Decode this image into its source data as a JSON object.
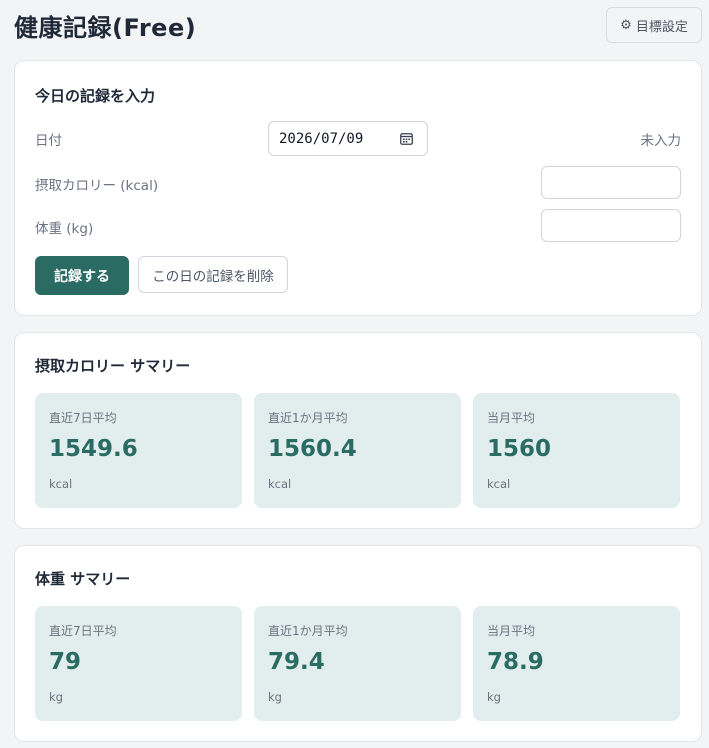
{
  "header": {
    "title": "健康記録(Free)",
    "goal_button_label": "目標設定"
  },
  "entry_form": {
    "title": "今日の記録を入力",
    "date_label": "日付",
    "date_value": "2026/07/09",
    "status": "未入力",
    "calorie_label": "摂取カロリー (kcal)",
    "calorie_value": "",
    "weight_label": "体重 (kg)",
    "weight_value": "",
    "save_button": "記録する",
    "delete_button": "この日の記録を削除"
  },
  "calorie_summary": {
    "title": "摂取カロリー サマリー",
    "stats": [
      {
        "label": "直近7日平均",
        "value": "1549.6",
        "unit": "kcal"
      },
      {
        "label": "直近1か月平均",
        "value": "1560.4",
        "unit": "kcal"
      },
      {
        "label": "当月平均",
        "value": "1560",
        "unit": "kcal"
      }
    ]
  },
  "weight_summary": {
    "title": "体重 サマリー",
    "stats": [
      {
        "label": "直近7日平均",
        "value": "79",
        "unit": "kg"
      },
      {
        "label": "直近1か月平均",
        "value": "79.4",
        "unit": "kg"
      },
      {
        "label": "当月平均",
        "value": "78.9",
        "unit": "kg"
      }
    ]
  },
  "colors": {
    "accent": "#2a6b63",
    "stat_bg": "#e2eeed",
    "page_bg": "#f3f4f6"
  }
}
